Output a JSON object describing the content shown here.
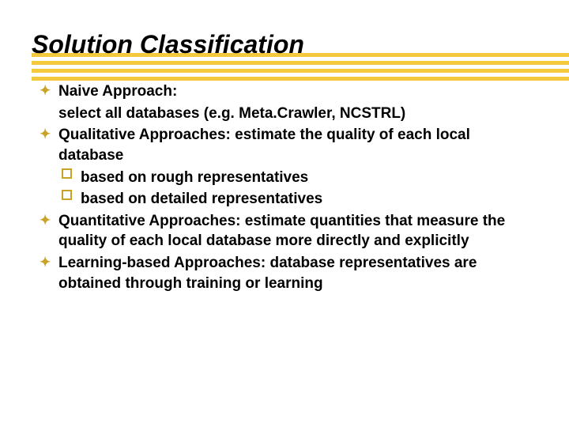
{
  "title": "Solution Classification",
  "bullets": {
    "naive_label": "Naive Approach:",
    "naive_body": "select all databases (e.g. Meta.Crawler, NCSTRL)",
    "qual_label": "Qualitative Approaches: ",
    "qual_body": "estimate the quality of each local database",
    "qual_sub1": "based on rough representatives",
    "qual_sub2": "based on detailed representatives",
    "quant_label": "Quantitative Approaches: ",
    "quant_body": "estimate quantities that measure the quality of each local database more directly and explicitly",
    "learn_label": "Learning-based Approaches: ",
    "learn_body": "database representatives are obtained through training or learning"
  }
}
